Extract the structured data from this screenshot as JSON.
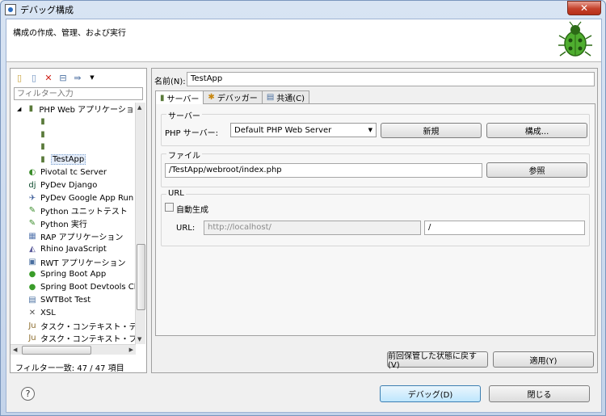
{
  "window": {
    "title": "デバッグ構成",
    "close_label": "✕"
  },
  "header": {
    "description": "構成の作成、管理、および実行"
  },
  "left": {
    "filter_placeholder": "フィルター入力",
    "tree": [
      {
        "label": "PHP Web アプリケーション",
        "indent": 1,
        "icon": "▮",
        "expanded": true
      },
      {
        "label": "",
        "indent": 2,
        "icon": "▮"
      },
      {
        "label": "",
        "indent": 2,
        "icon": "▮"
      },
      {
        "label": "",
        "indent": 2,
        "icon": "▮"
      },
      {
        "label": "TestApp",
        "indent": 2,
        "icon": "▮",
        "selected": true
      },
      {
        "label": "Pivotal tc Server",
        "indent": 1,
        "icon": "◐"
      },
      {
        "label": "PyDev Django",
        "indent": 1,
        "icon": "dj"
      },
      {
        "label": "PyDev Google App Run",
        "indent": 1,
        "icon": "✈"
      },
      {
        "label": "Python ユニットテスト",
        "indent": 1,
        "icon": "✎"
      },
      {
        "label": "Python 実行",
        "indent": 1,
        "icon": "✎"
      },
      {
        "label": "RAP アプリケーション",
        "indent": 1,
        "icon": "▦"
      },
      {
        "label": "Rhino JavaScript",
        "indent": 1,
        "icon": "◭"
      },
      {
        "label": "RWT アプリケーション",
        "indent": 1,
        "icon": "▣"
      },
      {
        "label": "Spring Boot App",
        "indent": 1,
        "icon": "●"
      },
      {
        "label": "Spring Boot Devtools Client",
        "indent": 1,
        "icon": "●"
      },
      {
        "label": "SWTBot Test",
        "indent": 1,
        "icon": "▤"
      },
      {
        "label": "XSL",
        "indent": 1,
        "icon": "✕"
      },
      {
        "label": "タスク・コンテキスト・テスト",
        "indent": 1,
        "icon": "Ju"
      },
      {
        "label": "タスク・コンテキスト・プラ",
        "indent": 1,
        "icon": "Ju"
      }
    ],
    "filter_count": "フィルター一致: 47 / 47 項目"
  },
  "right": {
    "name_label": "名前(N):",
    "name_value": "TestApp",
    "tabs": [
      {
        "label": "サーバー",
        "icon": "▮"
      },
      {
        "label": "デバッガー",
        "icon": "✱"
      },
      {
        "label": "共通(C)",
        "icon": "▤"
      }
    ],
    "server_group": {
      "title": "サーバー",
      "php_server_label": "PHP サーバー:",
      "php_server_value": "Default PHP Web Server",
      "new_button": "新規",
      "configure_button": "構成..."
    },
    "file_group": {
      "title": "ファイル",
      "file_value": "/TestApp/webroot/index.php",
      "browse_button": "参照"
    },
    "url_group": {
      "title": "URL",
      "auto_generate_label": "自動生成",
      "url_label": "URL:",
      "url_base_value": "http://localhost/",
      "url_path_value": "/"
    },
    "revert_button": "前回保管した状態に戻す(V)",
    "apply_button": "適用(Y)"
  },
  "footer": {
    "help_label": "?",
    "debug_button": "デバッグ(D)",
    "close_button": "閉じる"
  }
}
